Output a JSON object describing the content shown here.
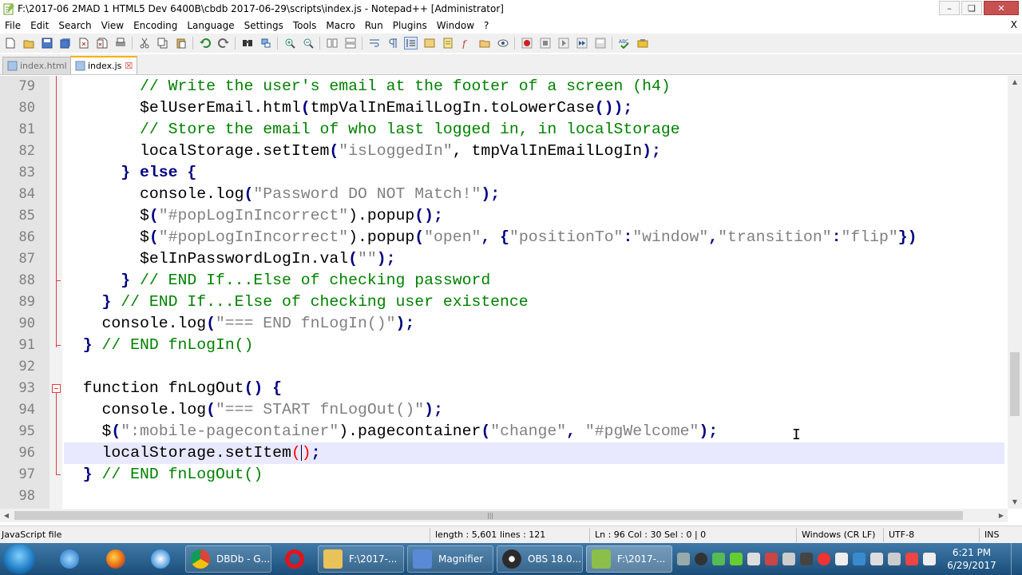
{
  "window": {
    "title": "F:\\2017-06 2MAD 1 HTML5 Dev 6400B\\cbdb 2017-06-29\\scripts\\index.js - Notepad++ [Administrator]",
    "minimize_glyph": "–",
    "maximize_glyph": "❏",
    "close_glyph": "✕"
  },
  "menu": {
    "items": [
      "File",
      "Edit",
      "Search",
      "View",
      "Encoding",
      "Language",
      "Settings",
      "Tools",
      "Macro",
      "Run",
      "Plugins",
      "Window",
      "?"
    ],
    "close_doc": "X"
  },
  "tabs": [
    {
      "label": "index.html",
      "active": false
    },
    {
      "label": "index.js",
      "active": true
    }
  ],
  "editor": {
    "current_line": 96,
    "lines": [
      {
        "num": "79"
      },
      {
        "num": "80"
      },
      {
        "num": "81"
      },
      {
        "num": "82"
      },
      {
        "num": "83"
      },
      {
        "num": "84"
      },
      {
        "num": "85"
      },
      {
        "num": "86"
      },
      {
        "num": "87"
      },
      {
        "num": "88"
      },
      {
        "num": "89"
      },
      {
        "num": "90"
      },
      {
        "num": "91"
      },
      {
        "num": "92"
      },
      {
        "num": "93"
      },
      {
        "num": "94"
      },
      {
        "num": "95"
      },
      {
        "num": "96"
      },
      {
        "num": "97"
      },
      {
        "num": "98"
      }
    ],
    "tokens": {
      "l79_c": "// Write the user's email at the footer of a screen (h4)",
      "l80_a": "$elUserEmail.html",
      "l80_b": "(",
      "l80_c": "tmpValInEmailLogIn.toLowerCase",
      "l80_d": "());",
      "l81_c": "// Store the email of who last logged in, in localStorage",
      "l82_a": "localStorage.setItem",
      "l82_b": "(",
      "l82_s": "\"isLoggedIn\"",
      "l82_c": ", tmpValInEmailLogIn",
      "l82_d": ");",
      "l83_a": "} else {",
      "l84_a": "console.log",
      "l84_b": "(",
      "l84_s": "\"Password DO NOT Match!\"",
      "l84_d": ");",
      "l85_a": "$",
      "l85_b": "(",
      "l85_s": "\"#popLogInIncorrect\"",
      "l85_c": ").popup",
      "l85_d": "();",
      "l86_a": "$",
      "l86_b": "(",
      "l86_s": "\"#popLogInIncorrect\"",
      "l86_c": ").popup",
      "l86_d": "(",
      "l86_s2": "\"open\"",
      "l86_e": ", {",
      "l86_s3": "\"positionTo\"",
      "l86_f": ":",
      "l86_s4": "\"window\"",
      "l86_g": ",",
      "l86_s5": "\"transition\"",
      "l86_h": ":",
      "l86_s6": "\"flip\"",
      "l86_i": "})",
      "l87_a": "$elInPasswordLogIn.val",
      "l87_b": "(",
      "l87_s": "\"\"",
      "l87_d": ");",
      "l88_a": "}",
      "l88_c": " // END If...Else of checking password",
      "l89_a": "}",
      "l89_c": " // END If...Else of checking user existence",
      "l90_a": "console.log",
      "l90_b": "(",
      "l90_s": "\"=== END fnLogIn()\"",
      "l90_d": ");",
      "l91_a": "}",
      "l91_c": " // END fnLogIn()",
      "l93_a": "function fnLogOut",
      "l93_b": "() {",
      "l94_a": "console.log",
      "l94_b": "(",
      "l94_s": "\"=== START fnLogOut()\"",
      "l94_d": ");",
      "l95_a": "$",
      "l95_b": "(",
      "l95_s": "\":mobile-pagecontainer\"",
      "l95_c": ").pagecontainer",
      "l95_d": "(",
      "l95_s2": "\"change\"",
      "l95_e": ", ",
      "l95_s3": "\"#pgWelcome\"",
      "l95_f": ");",
      "l96_a": "localStorage.setItem",
      "l96_b1": "(",
      "l96_b2": ")",
      "l96_d": ";",
      "l97_a": "}",
      "l97_c": " // END fnLogOut()"
    }
  },
  "statusbar": {
    "file_type": "JavaScript file",
    "length": "length : 5,601",
    "lines": "lines : 121",
    "position": "Ln : 96    Col : 30    Sel : 0 | 0",
    "eol": "Windows (CR LF)",
    "encoding": "UTF-8",
    "mode": "INS"
  },
  "taskbar": {
    "apps": [
      {
        "label": "DBDb - G...",
        "color": "#e8b400"
      },
      {
        "label": "F:\\2017-...",
        "color": "#e9c25a"
      },
      {
        "label": "Magnifier",
        "color": "#5a8ad6"
      },
      {
        "label": "OBS 18.0...",
        "color": "#2b2b2b"
      },
      {
        "label": "F:\\2017-...",
        "color": "#8bbf4a"
      }
    ],
    "time": "6:21 PM",
    "date": "6/29/2017"
  },
  "colors": {
    "comment": "#008000",
    "string": "#808080",
    "operator": "#000080",
    "current_line": "#e8e8ff",
    "gutter": "#e4e4e4",
    "active_tab_accent": "#fab000"
  }
}
